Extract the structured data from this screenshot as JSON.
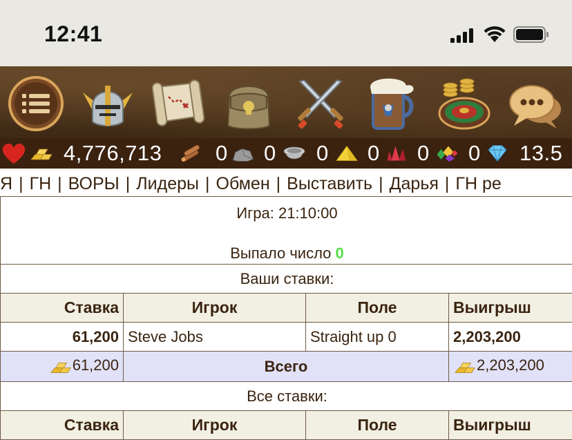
{
  "status_bar": {
    "time": "12:41"
  },
  "toolbar": {
    "items": [
      {
        "name": "menu-icon"
      },
      {
        "name": "helmet-icon"
      },
      {
        "name": "map-scroll-icon"
      },
      {
        "name": "backpack-icon"
      },
      {
        "name": "crossed-swords-icon"
      },
      {
        "name": "beer-mug-icon"
      },
      {
        "name": "roulette-icon"
      },
      {
        "name": "chat-icon"
      }
    ]
  },
  "resources": {
    "gold": "4,776,713",
    "wood": "0",
    "stone": "0",
    "mercury": "0",
    "sulfur": "0",
    "crystal": "0",
    "gems": "0",
    "diamonds": "13.5"
  },
  "nav": [
    "Я",
    "ГН",
    "ВОРЫ",
    "Лидеры",
    "Обмен",
    "Выставить",
    "Дарья",
    "ГН ре"
  ],
  "game": {
    "time_label": "Игра: 21:10:00",
    "result_label": "Выпало число",
    "result_number": "0",
    "your_bets_title": "Ваши ставки:",
    "all_bets_title": "Все ставки:"
  },
  "table": {
    "headers": {
      "bet": "Ставка",
      "player": "Игрок",
      "field": "Поле",
      "win": "Выигрыш"
    },
    "rows": [
      {
        "bet": "61,200",
        "player": "Steve Jobs",
        "field": "Straight up 0",
        "win": "2,203,200"
      }
    ],
    "total": {
      "bet": "61,200",
      "label": "Всего",
      "win": "2,203,200"
    },
    "cut_headers": {
      "bet": "Ставка",
      "player": "Игрок",
      "field": "Поле",
      "win": "Выигрыш"
    }
  },
  "colors": {
    "toolbar_bg": "#4a321c",
    "resource_bg": "#3b220f",
    "text_brown": "#3a2410",
    "header_bg": "#f2efe3",
    "total_bg": "#e1e1f8",
    "result_green": "#55dd44"
  }
}
